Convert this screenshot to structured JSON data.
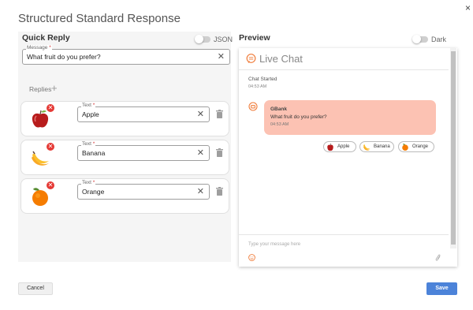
{
  "dialog": {
    "title": "Structured Standard Response",
    "close_glyph": "×"
  },
  "quick_reply": {
    "header": "Quick Reply",
    "json_toggle_label": "JSON",
    "message": {
      "label": "Message",
      "required_mark": "*",
      "value": "What fruit do you prefer?"
    },
    "replies_label": "Replies",
    "add_glyph": "+",
    "replies": [
      {
        "icon": "apple-icon",
        "label": "Text",
        "required_mark": "*",
        "value": "Apple"
      },
      {
        "icon": "banana-icon",
        "label": "Text",
        "required_mark": "*",
        "value": "Banana"
      },
      {
        "icon": "orange-icon",
        "label": "Text",
        "required_mark": "*",
        "value": "Orange"
      }
    ]
  },
  "preview": {
    "header": "Preview",
    "dark_toggle_label": "Dark",
    "chat_title": "Live Chat",
    "chat_started": "Chat Started",
    "chat_started_time": "04:53 AM",
    "bot_name": "GBank",
    "bot_message": "What fruit do you prefer?",
    "bot_message_time": "04:53 AM",
    "chips": [
      "Apple",
      "Banana",
      "Orange"
    ],
    "input_placeholder": "Type your message here"
  },
  "footer": {
    "cancel_label": "Cancel",
    "save_label": "Save"
  },
  "colors": {
    "bubble": "#fcc2b3",
    "accent_orange": "#f07c3a",
    "save_button": "#4c83d9",
    "remove_badge": "#e53935"
  }
}
